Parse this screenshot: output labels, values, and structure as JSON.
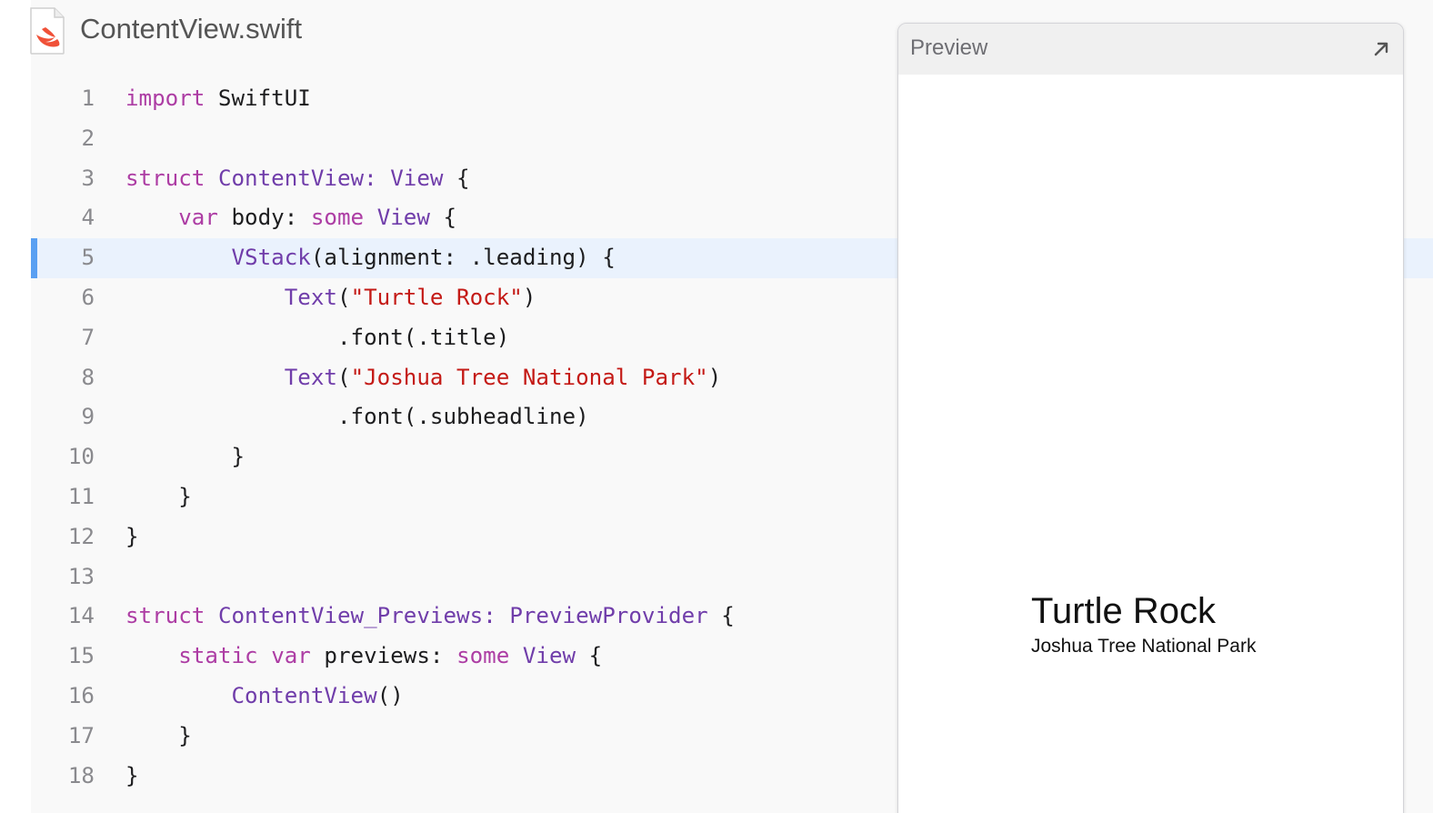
{
  "file": {
    "name": "ContentView.swift",
    "icon": "swift-file-icon"
  },
  "code_lines": [
    {
      "n": "1",
      "tokens": [
        {
          "t": "import",
          "c": "kw"
        },
        {
          "t": " SwiftUI",
          "c": "pl"
        }
      ]
    },
    {
      "n": "2",
      "tokens": []
    },
    {
      "n": "3",
      "tokens": [
        {
          "t": "struct",
          "c": "kw"
        },
        {
          "t": " ",
          "c": "pl"
        },
        {
          "t": "ContentView",
          "c": "ty"
        },
        {
          "t": ": ",
          "c": "ty"
        },
        {
          "t": "View",
          "c": "ty"
        },
        {
          "t": " {",
          "c": "pl"
        }
      ]
    },
    {
      "n": "4",
      "tokens": [
        {
          "t": "    ",
          "c": "pl"
        },
        {
          "t": "var",
          "c": "kw"
        },
        {
          "t": " body: ",
          "c": "pl"
        },
        {
          "t": "some",
          "c": "kw"
        },
        {
          "t": " ",
          "c": "pl"
        },
        {
          "t": "View",
          "c": "ty"
        },
        {
          "t": " {",
          "c": "pl"
        }
      ]
    },
    {
      "n": "5",
      "tokens": [
        {
          "t": "        ",
          "c": "pl"
        },
        {
          "t": "VStack",
          "c": "ty"
        },
        {
          "t": "(alignment: .leading) {",
          "c": "pl"
        }
      ],
      "highlight": true
    },
    {
      "n": "6",
      "tokens": [
        {
          "t": "            ",
          "c": "pl"
        },
        {
          "t": "Text",
          "c": "ty"
        },
        {
          "t": "(",
          "c": "pl"
        },
        {
          "t": "\"Turtle Rock\"",
          "c": "str"
        },
        {
          "t": ")",
          "c": "pl"
        }
      ]
    },
    {
      "n": "7",
      "tokens": [
        {
          "t": "                .font(.title)",
          "c": "pl"
        }
      ]
    },
    {
      "n": "8",
      "tokens": [
        {
          "t": "            ",
          "c": "pl"
        },
        {
          "t": "Text",
          "c": "ty"
        },
        {
          "t": "(",
          "c": "pl"
        },
        {
          "t": "\"Joshua Tree National Park\"",
          "c": "str"
        },
        {
          "t": ")",
          "c": "pl"
        }
      ]
    },
    {
      "n": "9",
      "tokens": [
        {
          "t": "                .font(.subheadline)",
          "c": "pl"
        }
      ]
    },
    {
      "n": "10",
      "tokens": [
        {
          "t": "        }",
          "c": "pl"
        }
      ]
    },
    {
      "n": "11",
      "tokens": [
        {
          "t": "    }",
          "c": "pl"
        }
      ]
    },
    {
      "n": "12",
      "tokens": [
        {
          "t": "}",
          "c": "pl"
        }
      ]
    },
    {
      "n": "13",
      "tokens": []
    },
    {
      "n": "14",
      "tokens": [
        {
          "t": "struct",
          "c": "kw"
        },
        {
          "t": " ",
          "c": "pl"
        },
        {
          "t": "ContentView_Previews",
          "c": "ty"
        },
        {
          "t": ": ",
          "c": "ty"
        },
        {
          "t": "PreviewProvider",
          "c": "ty"
        },
        {
          "t": " {",
          "c": "pl"
        }
      ]
    },
    {
      "n": "15",
      "tokens": [
        {
          "t": "    ",
          "c": "pl"
        },
        {
          "t": "static",
          "c": "kw"
        },
        {
          "t": " ",
          "c": "pl"
        },
        {
          "t": "var",
          "c": "kw"
        },
        {
          "t": " previews: ",
          "c": "pl"
        },
        {
          "t": "some",
          "c": "kw"
        },
        {
          "t": " ",
          "c": "pl"
        },
        {
          "t": "View",
          "c": "ty"
        },
        {
          "t": " {",
          "c": "pl"
        }
      ]
    },
    {
      "n": "16",
      "tokens": [
        {
          "t": "        ",
          "c": "pl"
        },
        {
          "t": "ContentView",
          "c": "ty"
        },
        {
          "t": "()",
          "c": "pl"
        }
      ]
    },
    {
      "n": "17",
      "tokens": [
        {
          "t": "    }",
          "c": "pl"
        }
      ]
    },
    {
      "n": "18",
      "tokens": [
        {
          "t": "}",
          "c": "pl"
        }
      ]
    }
  ],
  "preview": {
    "header_title": "Preview",
    "expand_icon": "arrow-up-right-icon",
    "title_text": "Turtle Rock",
    "subtitle_text": "Joshua Tree National Park"
  },
  "colors": {
    "keyword": "#ad3da4",
    "type": "#703daa",
    "string": "#c41a16",
    "highlight_bar": "#5aa0f2",
    "highlight_bg": "#eaf2fd"
  }
}
